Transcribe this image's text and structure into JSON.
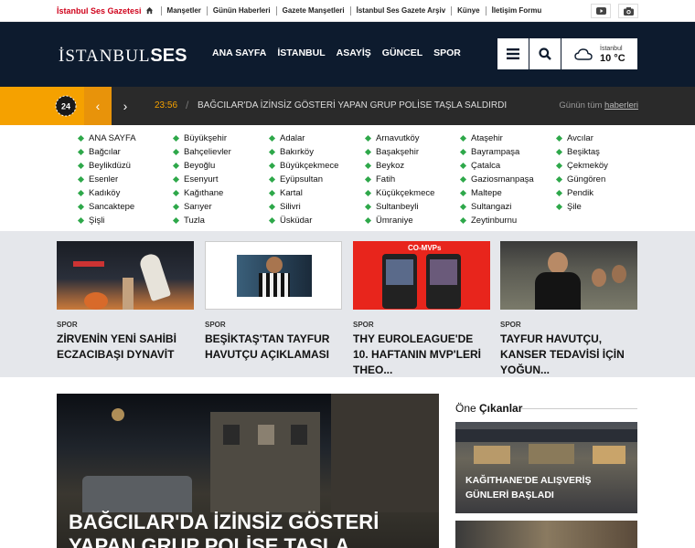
{
  "topbar": {
    "brand": "İstanbul Ses Gazetesi",
    "links": [
      "Manşetler",
      "Günün Haberleri",
      "Gazete Manşetleri",
      "İstanbul Ses Gazete Arşiv",
      "Künye",
      "İletişim Formu"
    ]
  },
  "header": {
    "logo_left": "İSTANBUL",
    "logo_right": "SES",
    "nav": [
      "ANA SAYFA",
      "İSTANBUL",
      "ASAYİŞ",
      "GÜNCEL",
      "SPOR"
    ],
    "weather_city": "İstanbul",
    "weather_temp": "10 °C"
  },
  "breaking": {
    "badge": "24",
    "time": "23:56",
    "sep": "/",
    "headline": "BAĞCILAR'DA İZİNSİZ GÖSTERİ YAPAN GRUP POLİSE TAŞLA SALDIRDI",
    "all_prefix": "Günün tüm ",
    "all_link": "haberleri"
  },
  "districts": [
    [
      "ANA SAYFA",
      "Bağcılar",
      "Beylikdüzü",
      "Esenler",
      "Kadıköy",
      "Sancaktepe",
      "Şişli"
    ],
    [
      "Büyükşehir",
      "Bahçelievler",
      "Beyoğlu",
      "Esenyurt",
      "Kağıthane",
      "Sarıyer",
      "Tuzla"
    ],
    [
      "Adalar",
      "Bakırköy",
      "Büyükçekmece",
      "Eyüpsultan",
      "Kartal",
      "Silivri",
      "Üsküdar"
    ],
    [
      "Arnavutköy",
      "Başakşehir",
      "Beykoz",
      "Fatih",
      "Küçükçekmece",
      "Sultanbeyli",
      "Ümraniye"
    ],
    [
      "Ataşehir",
      "Bayrampaşa",
      "Çatalca",
      "Gaziosmanpaşa",
      "Maltepe",
      "Sultangazi",
      "Zeytinburnu"
    ],
    [
      "Avcılar",
      "Beşiktaş",
      "Çekmeköy",
      "Güngören",
      "Pendik",
      "Şile"
    ]
  ],
  "cards": [
    {
      "cat": "SPOR",
      "title": "ZİRVENİN YENİ SAHİBİ ECZACIBAŞI DYNAVİT"
    },
    {
      "cat": "SPOR",
      "title": "BEŞİKTAŞ'TAN TAYFUR HAVUTÇU AÇIKLAMASI"
    },
    {
      "cat": "SPOR",
      "title": "THY EUROLEAGUE'DE 10. HAFTANIN MVP'LERİ THEO..."
    },
    {
      "cat": "SPOR",
      "title": "TAYFUR HAVUTÇU, KANSER TEDAVİSİ İÇİN YOĞUN..."
    }
  ],
  "card3_overlay": "CO-MVPs",
  "hero": {
    "title": "BAĞCILAR'DA İZİNSİZ GÖSTERİ YAPAN GRUP POLİSE TAŞLA"
  },
  "side": {
    "heading_a": "Öne ",
    "heading_b": "Çıkanlar",
    "card_title": "KAĞITHANE'DE ALIŞVERİŞ GÜNLERİ BAŞLADI"
  },
  "colors": {
    "navy": "#0d1b2e",
    "accent_orange": "#f5a100",
    "accent_red": "#d0021b",
    "bullet_green": "#2ea84a"
  }
}
